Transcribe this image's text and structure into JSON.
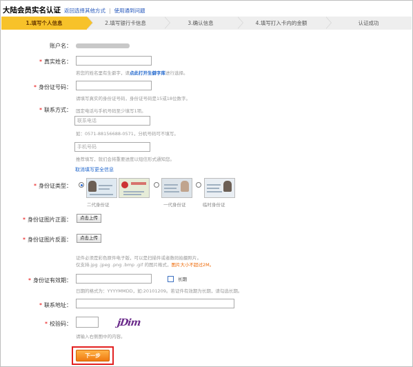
{
  "header": {
    "title": "大陆会员实名认证",
    "link_other": "返回选择其他方式",
    "separator": "|",
    "link_cert": "使用通到问题"
  },
  "steps": [
    {
      "label": "1.填写个人信息",
      "active": true
    },
    {
      "label": "2.填写银行卡信息",
      "active": false
    },
    {
      "label": "3.确认信息",
      "active": false
    },
    {
      "label": "4.填写打入卡内的金额",
      "active": false
    },
    {
      "label": "认证成功",
      "active": false
    }
  ],
  "form": {
    "account": {
      "label": "账户名："
    },
    "real_name": {
      "label": "真实姓名：",
      "value": "",
      "hint_pre": "若您的姓名里有生僻字，请",
      "hint_link": "点此打开生僻字库",
      "hint_post": "进行选择。"
    },
    "id_number": {
      "label": "身份证号码：",
      "value": "",
      "hint": "请填写真实的身份证号码，身份证号码是15或18位数字。"
    },
    "contact": {
      "label": "联系方式：",
      "hint": "固定电话与手机号码至少填写1项。",
      "phone_placeholder": "联系电话",
      "phone_hint": "如：0571-88156688-0571，分机号码可不填写。",
      "mobile_placeholder": "手机号码",
      "mobile_hint": "推荐填写，就们会将重要进度以短信形式通知您。",
      "cancel_link": "取消填写更全信息"
    },
    "id_type": {
      "label": "身份证类型：",
      "options": [
        {
          "label": "二代身份证",
          "selected": true
        },
        {
          "label": "一代身份证",
          "selected": false
        },
        {
          "label": "临时身份证",
          "selected": false
        }
      ]
    },
    "id_front": {
      "label": "身份证图片正面：",
      "button": "点击上传"
    },
    "id_back": {
      "label": "身份证图片反面：",
      "button": "点击上传"
    },
    "upload_hint_1": "证件必须是彩色原件电子版，可以是扫描件或者数码拍摄照片。",
    "upload_hint_2": "仅支持.jpg .jpeg .png .bmp .gif 的图片格式，",
    "upload_hint_red": "图片大小不超过2M。",
    "validity": {
      "label": "身份证有效期：",
      "value": "",
      "checkbox_label": "长期",
      "hint": "日期的格式为：YYYYMMDD，如:20101209。若证件有效期为长期，请勾选长期。"
    },
    "address": {
      "label": "联系地址：",
      "value": ""
    },
    "captcha": {
      "label": "校验码：",
      "value": "",
      "image_text": "jDim",
      "hint": "请输入右侧图中的内容。"
    },
    "next_button": "下一步"
  },
  "colors": {
    "accent": "#f7c22a",
    "required": "#e60000",
    "link": "#1f66cc",
    "warning": "#ee6600",
    "button": "#f07a10",
    "highlight_border": "#e21f1f"
  }
}
